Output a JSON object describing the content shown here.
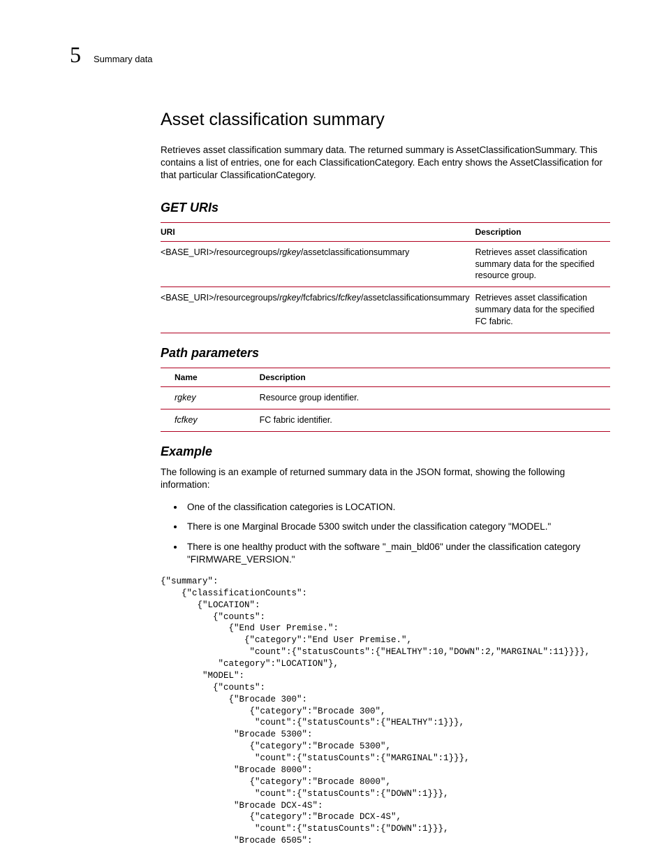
{
  "header": {
    "chapter_number": "5",
    "running_head": "Summary data"
  },
  "section": {
    "title": "Asset classification summary",
    "intro": "Retrieves asset classification summary data. The returned summary is AssetClassificationSummary. This contains a list of entries, one for each ClassificationCategory. Each entry shows the AssetClassification for that particular ClassificationCategory."
  },
  "get_uris": {
    "heading": "GET URIs",
    "columns": {
      "uri": "URI",
      "description": "Description"
    },
    "rows": [
      {
        "uri_prefix": "<BASE_URI>/resourcegroups/",
        "uri_param1": "rgkey",
        "uri_suffix": "/assetclassificationsummary",
        "description": "Retrieves asset classification summary data for the specified resource group."
      },
      {
        "uri_prefix": "<BASE_URI>/resourcegroups/",
        "uri_param1": "rgkey",
        "uri_mid": "/fcfabrics/",
        "uri_param2": "fcfkey",
        "uri_suffix": "/assetclassificationsummary",
        "description": "Retrieves asset classification summary data for the specified FC fabric."
      }
    ]
  },
  "path_params": {
    "heading": "Path parameters",
    "columns": {
      "name": "Name",
      "description": "Description"
    },
    "rows": [
      {
        "name": "rgkey",
        "description": "Resource group identifier."
      },
      {
        "name": "fcfkey",
        "description": "FC fabric identifier."
      }
    ]
  },
  "example": {
    "heading": "Example",
    "intro": "The following is an example of returned summary data in the JSON format, showing the following information:",
    "bullets": [
      "One of the classification categories is LOCATION.",
      "There is one Marginal Brocade 5300 switch under the classification category \"MODEL.\"",
      "There is one healthy product with the software \"_main_bld06\" under the classification category \"FIRMWARE_VERSION.\""
    ],
    "code": "{\"summary\":\n    {\"classificationCounts\":\n       {\"LOCATION\":\n          {\"counts\":\n             {\"End User Premise.\":\n                {\"category\":\"End User Premise.\",\n                 \"count\":{\"statusCounts\":{\"HEALTHY\":10,\"DOWN\":2,\"MARGINAL\":11}}}},\n           \"category\":\"LOCATION\"},\n        \"MODEL\":\n          {\"counts\":\n             {\"Brocade 300\":\n                 {\"category\":\"Brocade 300\",\n                  \"count\":{\"statusCounts\":{\"HEALTHY\":1}}},\n              \"Brocade 5300\":\n                 {\"category\":\"Brocade 5300\",\n                  \"count\":{\"statusCounts\":{\"MARGINAL\":1}}},\n              \"Brocade 8000\":\n                 {\"category\":\"Brocade 8000\",\n                  \"count\":{\"statusCounts\":{\"DOWN\":1}}},\n              \"Brocade DCX-4S\":\n                 {\"category\":\"Brocade DCX-4S\",\n                  \"count\":{\"statusCounts\":{\"DOWN\":1}}},\n              \"Brocade 6505\":"
  }
}
